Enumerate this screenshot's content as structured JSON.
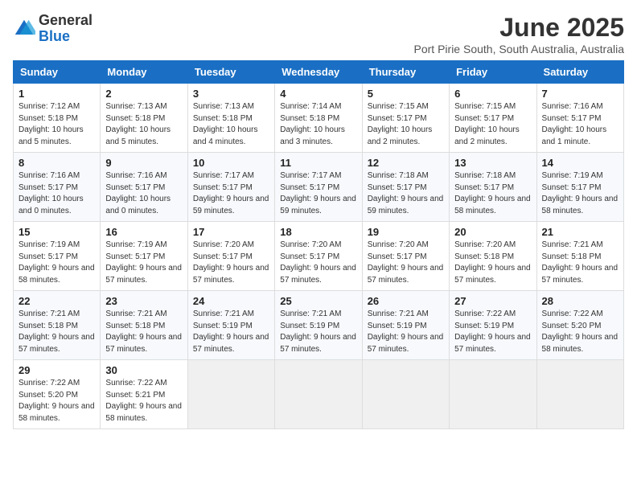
{
  "header": {
    "logo_general": "General",
    "logo_blue": "Blue",
    "month_year": "June 2025",
    "location": "Port Pirie South, South Australia, Australia"
  },
  "calendar": {
    "days_of_week": [
      "Sunday",
      "Monday",
      "Tuesday",
      "Wednesday",
      "Thursday",
      "Friday",
      "Saturday"
    ],
    "weeks": [
      [
        {
          "day": "1",
          "sunrise": "7:12 AM",
          "sunset": "5:18 PM",
          "daylight": "10 hours and 5 minutes."
        },
        {
          "day": "2",
          "sunrise": "7:13 AM",
          "sunset": "5:18 PM",
          "daylight": "10 hours and 5 minutes."
        },
        {
          "day": "3",
          "sunrise": "7:13 AM",
          "sunset": "5:18 PM",
          "daylight": "10 hours and 4 minutes."
        },
        {
          "day": "4",
          "sunrise": "7:14 AM",
          "sunset": "5:18 PM",
          "daylight": "10 hours and 3 minutes."
        },
        {
          "day": "5",
          "sunrise": "7:15 AM",
          "sunset": "5:17 PM",
          "daylight": "10 hours and 2 minutes."
        },
        {
          "day": "6",
          "sunrise": "7:15 AM",
          "sunset": "5:17 PM",
          "daylight": "10 hours and 2 minutes."
        },
        {
          "day": "7",
          "sunrise": "7:16 AM",
          "sunset": "5:17 PM",
          "daylight": "10 hours and 1 minute."
        }
      ],
      [
        {
          "day": "8",
          "sunrise": "7:16 AM",
          "sunset": "5:17 PM",
          "daylight": "10 hours and 0 minutes."
        },
        {
          "day": "9",
          "sunrise": "7:16 AM",
          "sunset": "5:17 PM",
          "daylight": "10 hours and 0 minutes."
        },
        {
          "day": "10",
          "sunrise": "7:17 AM",
          "sunset": "5:17 PM",
          "daylight": "9 hours and 59 minutes."
        },
        {
          "day": "11",
          "sunrise": "7:17 AM",
          "sunset": "5:17 PM",
          "daylight": "9 hours and 59 minutes."
        },
        {
          "day": "12",
          "sunrise": "7:18 AM",
          "sunset": "5:17 PM",
          "daylight": "9 hours and 59 minutes."
        },
        {
          "day": "13",
          "sunrise": "7:18 AM",
          "sunset": "5:17 PM",
          "daylight": "9 hours and 58 minutes."
        },
        {
          "day": "14",
          "sunrise": "7:19 AM",
          "sunset": "5:17 PM",
          "daylight": "9 hours and 58 minutes."
        }
      ],
      [
        {
          "day": "15",
          "sunrise": "7:19 AM",
          "sunset": "5:17 PM",
          "daylight": "9 hours and 58 minutes."
        },
        {
          "day": "16",
          "sunrise": "7:19 AM",
          "sunset": "5:17 PM",
          "daylight": "9 hours and 57 minutes."
        },
        {
          "day": "17",
          "sunrise": "7:20 AM",
          "sunset": "5:17 PM",
          "daylight": "9 hours and 57 minutes."
        },
        {
          "day": "18",
          "sunrise": "7:20 AM",
          "sunset": "5:17 PM",
          "daylight": "9 hours and 57 minutes."
        },
        {
          "day": "19",
          "sunrise": "7:20 AM",
          "sunset": "5:17 PM",
          "daylight": "9 hours and 57 minutes."
        },
        {
          "day": "20",
          "sunrise": "7:20 AM",
          "sunset": "5:18 PM",
          "daylight": "9 hours and 57 minutes."
        },
        {
          "day": "21",
          "sunrise": "7:21 AM",
          "sunset": "5:18 PM",
          "daylight": "9 hours and 57 minutes."
        }
      ],
      [
        {
          "day": "22",
          "sunrise": "7:21 AM",
          "sunset": "5:18 PM",
          "daylight": "9 hours and 57 minutes."
        },
        {
          "day": "23",
          "sunrise": "7:21 AM",
          "sunset": "5:18 PM",
          "daylight": "9 hours and 57 minutes."
        },
        {
          "day": "24",
          "sunrise": "7:21 AM",
          "sunset": "5:19 PM",
          "daylight": "9 hours and 57 minutes."
        },
        {
          "day": "25",
          "sunrise": "7:21 AM",
          "sunset": "5:19 PM",
          "daylight": "9 hours and 57 minutes."
        },
        {
          "day": "26",
          "sunrise": "7:21 AM",
          "sunset": "5:19 PM",
          "daylight": "9 hours and 57 minutes."
        },
        {
          "day": "27",
          "sunrise": "7:22 AM",
          "sunset": "5:19 PM",
          "daylight": "9 hours and 57 minutes."
        },
        {
          "day": "28",
          "sunrise": "7:22 AM",
          "sunset": "5:20 PM",
          "daylight": "9 hours and 58 minutes."
        }
      ],
      [
        {
          "day": "29",
          "sunrise": "7:22 AM",
          "sunset": "5:20 PM",
          "daylight": "9 hours and 58 minutes."
        },
        {
          "day": "30",
          "sunrise": "7:22 AM",
          "sunset": "5:21 PM",
          "daylight": "9 hours and 58 minutes."
        },
        null,
        null,
        null,
        null,
        null
      ]
    ]
  }
}
